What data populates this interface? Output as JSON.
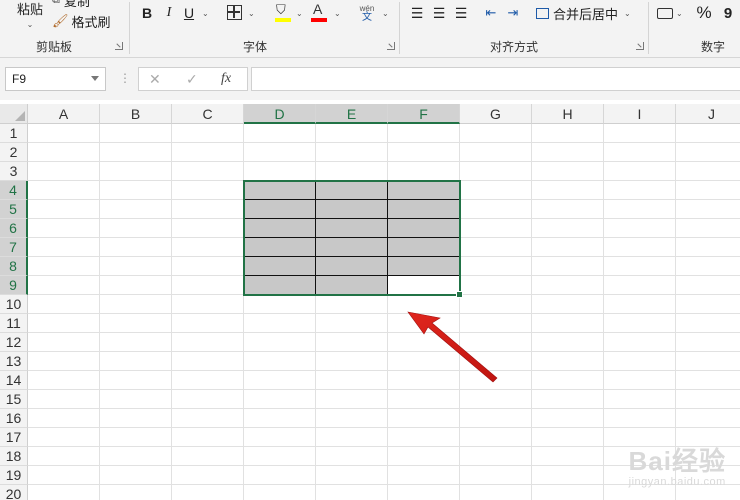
{
  "ribbon": {
    "clipboard": {
      "paste_label": "粘贴",
      "copy_label": "复制",
      "format_painter_label": "格式刷",
      "group_label": "剪贴板"
    },
    "font": {
      "bold": "B",
      "italic": "I",
      "underline": "U",
      "group_label": "字体"
    },
    "alignment": {
      "wrap_label": "wén",
      "merge_label": "合并后居中",
      "group_label": "对齐方式"
    },
    "number": {
      "percent": "%",
      "group_label": "数字"
    },
    "colors": {
      "highlight": "#ffff00",
      "font_color": "#ff0000",
      "accent": "#217346"
    }
  },
  "formula_bar": {
    "name_box": "F9",
    "cancel_icon": "✕",
    "enter_icon": "✓",
    "fx_label": "fx",
    "formula": ""
  },
  "grid": {
    "columns": [
      "A",
      "B",
      "C",
      "D",
      "E",
      "F",
      "G",
      "H",
      "I",
      "J"
    ],
    "selected_columns": [
      "D",
      "E",
      "F"
    ],
    "rows": [
      "1",
      "2",
      "3",
      "4",
      "5",
      "6",
      "7",
      "8",
      "9",
      "10",
      "11",
      "12",
      "13",
      "14",
      "15",
      "16",
      "17",
      "18",
      "19",
      "20"
    ],
    "selected_rows": [
      "4",
      "5",
      "6",
      "7",
      "8",
      "9"
    ],
    "selection_range": "D4:F9",
    "active_cell": "F9",
    "filled_fill_color": "#c8c8c8"
  },
  "watermark": {
    "logo": "Bai经验",
    "url": "jingyan.baidu.com"
  }
}
